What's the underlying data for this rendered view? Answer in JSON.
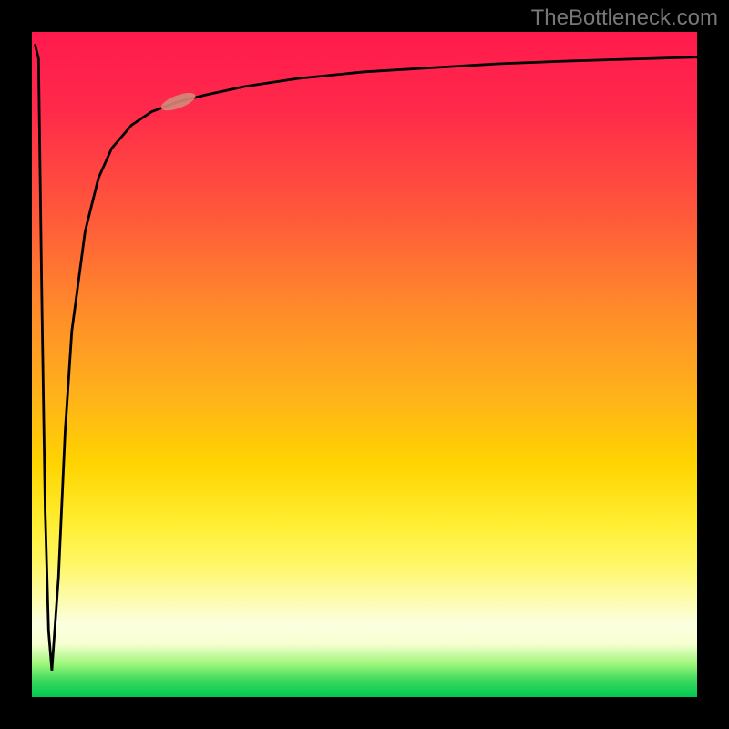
{
  "watermark": "TheBottleneck.com",
  "colors": {
    "gradient_top": "#ff1a4d",
    "gradient_mid": "#ffd400",
    "gradient_bottom": "#00c853",
    "curve": "#000000",
    "marker": "#d48a7a",
    "frame": "#000000"
  },
  "chart_data": {
    "type": "line",
    "title": "",
    "xlabel": "",
    "ylabel": "",
    "xlim": [
      0,
      100
    ],
    "ylim": [
      0,
      100
    ],
    "grid": false,
    "series": [
      {
        "name": "bottleneck-curve",
        "x": [
          0.5,
          1.0,
          1.5,
          2.0,
          2.5,
          3.0,
          4.0,
          5.0,
          6.0,
          8.0,
          10.0,
          12.0,
          15.0,
          18.0,
          22.0,
          26.0,
          32.0,
          40.0,
          50.0,
          60.0,
          70.0,
          80.0,
          90.0,
          100.0
        ],
        "y": [
          98.0,
          96.0,
          60.0,
          28.0,
          10.0,
          4.0,
          18.0,
          40.0,
          55.0,
          70.0,
          78.0,
          82.5,
          86.0,
          88.0,
          89.5,
          90.5,
          91.8,
          93.0,
          94.0,
          94.6,
          95.2,
          95.6,
          95.9,
          96.2
        ]
      }
    ],
    "marker": {
      "x": 22.0,
      "y": 89.5,
      "label": ""
    },
    "background_scale": {
      "description": "vertical red-yellow-green gradient, red at top (high bottleneck), green at bottom (low bottleneck)",
      "top_color": "#ff1a4d",
      "bottom_color": "#00c853"
    }
  }
}
